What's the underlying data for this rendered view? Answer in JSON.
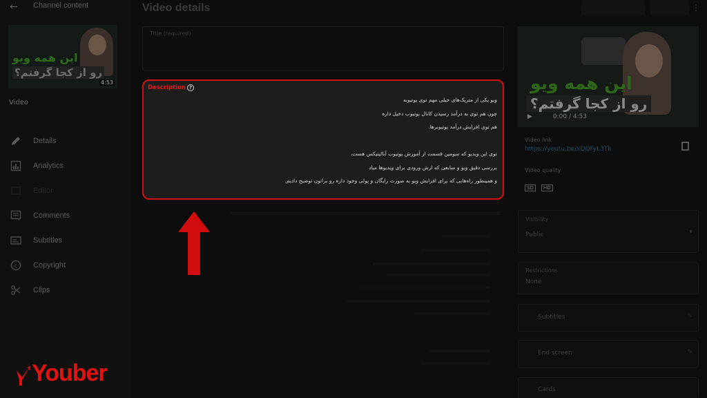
{
  "header": {
    "channel_content": "Channel content",
    "title": "Video details"
  },
  "sidebar": {
    "video_label": "Video",
    "thumb_line1": "این همه ویو",
    "thumb_line2": "رو از کجا گرفتم؟",
    "thumb_duration": "4:53",
    "items": [
      {
        "label": "Details",
        "icon": "pencil-icon"
      },
      {
        "label": "Analytics",
        "icon": "analytics-icon"
      },
      {
        "label": "Editor",
        "icon": "editor-icon"
      },
      {
        "label": "Comments",
        "icon": "comments-icon"
      },
      {
        "label": "Subtitles",
        "icon": "subtitles-icon"
      },
      {
        "label": "Copyright",
        "icon": "copyright-icon"
      },
      {
        "label": "Clips",
        "icon": "scissors-icon"
      }
    ]
  },
  "title_field": {
    "label": "Title (required)"
  },
  "description": {
    "label": "Description",
    "lines": [
      "ویو یکی از متریک‌های خیلی مهم توی یوتیوبه",
      "چون هم توی به درآمد رسیدن کانال یوتیوب دخیل داره",
      "هم توی افزایش درآمد یوتیوبرها.",
      "",
      "توی این ویدیو که سومین قسمت از آموزش یوتیوب آنالیتیکس هست،",
      "بررسی دقیق ویو و منابعی که ازش ورودی برای ویدیوها میاد",
      "و همینطور راه‌هایی که برای افزایش ویو به صورت رایگان و پولی وجود داره رو براتون توضیح دادیم."
    ]
  },
  "preview": {
    "line1": "این همه ویو",
    "line2": "رو از کجا گرفتم؟",
    "time": "0:00 / 4:53",
    "video_link_label": "Video link",
    "video_link": "https://youtu.be/xDQFyL3Tk",
    "quality_label": "Video quality",
    "quality_badges": [
      "SD",
      "HD"
    ]
  },
  "right_panels": {
    "visibility_label": "Visibility",
    "visibility_value": "Public",
    "restrictions_label": "Restrictions",
    "restrictions_value": "None",
    "subtitles": "Subtitles",
    "end_screen": "End screen",
    "cards": "Cards"
  },
  "logo": {
    "text": "Youber",
    "color": "#e31212"
  },
  "colors": {
    "accent": "#e31b1b",
    "background": "#0d0d0d",
    "description_bg": "#1d1d1d"
  }
}
